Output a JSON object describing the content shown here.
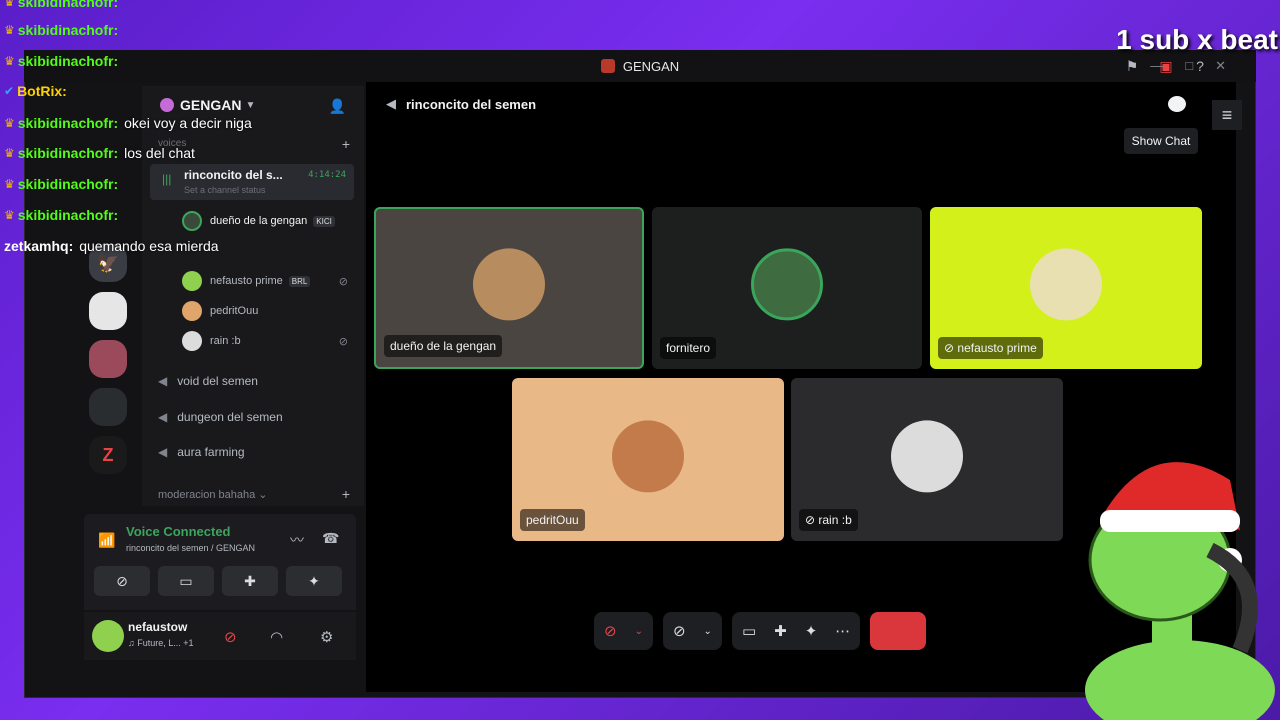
{
  "window": {
    "title": "GENGAN"
  },
  "server": {
    "name": "GENGAN"
  },
  "channels": {
    "voice_category": "voices",
    "active": {
      "name": "rinconcito del s...",
      "status": "Set a channel status",
      "timer": "4:14:24"
    },
    "members": [
      {
        "name": "dueño de la gengan",
        "badge": "KICI",
        "color": "#3a4a3a"
      },
      {
        "name": "nefausto prime",
        "badge": "BRL",
        "color": "#8fd14f"
      },
      {
        "name": "pedritOuu",
        "badge": "",
        "color": "#e0a56a"
      },
      {
        "name": "rain :b",
        "badge": "",
        "color": "#555"
      }
    ],
    "others": [
      "void del semen",
      "dungeon del semen",
      "aura farming"
    ],
    "category2": "moderacion bahaha"
  },
  "voice_panel": {
    "status": "Voice Connected",
    "location": "rinconcito del semen / GENGAN"
  },
  "user": {
    "name": "nefaustow",
    "status": "♫ Future, L... +1"
  },
  "call": {
    "channel": "rinconcito del semen",
    "show_chat": "Show Chat",
    "tiles": [
      {
        "name": "dueño de la gengan",
        "bg": "#4a4540",
        "av": "#b78c5e"
      },
      {
        "name": "fornitero",
        "bg": "#1c1f1d",
        "av": "#3e6b3f"
      },
      {
        "name": "nefausto prime",
        "bg": "#d4f01a",
        "av": "#e8e0b0"
      },
      {
        "name": "pedritOuu",
        "bg": "#e8b886",
        "av": "#c47b4b"
      },
      {
        "name": "rain :b",
        "bg": "#2b2b2d",
        "av": "#dcdcdc"
      }
    ]
  },
  "stream_chat": [
    {
      "user": "skibidinachofr:",
      "msg": "",
      "type": "crown"
    },
    {
      "user": "skibidinachofr:",
      "msg": "",
      "type": "crown"
    },
    {
      "user": "BotRix:",
      "msg": "",
      "type": "bot"
    },
    {
      "user": "skibidinachofr:",
      "msg": "okei voy a decir niga",
      "type": "crown"
    },
    {
      "user": "skibidinachofr:",
      "msg": "los del chat",
      "type": "crown"
    },
    {
      "user": "skibidinachofr:",
      "msg": "",
      "type": "crown"
    },
    {
      "user": "skibidinachofr:",
      "msg": "",
      "type": "crown"
    },
    {
      "user": "zetkamhq:",
      "msg": "quemando esa mierda",
      "type": "plain"
    }
  ],
  "overlay": {
    "sub_goal": "1 sub x beat"
  },
  "colors": {
    "accent_green": "#3ba55c",
    "danger": "#da373c",
    "kick_green": "#53fc18"
  }
}
